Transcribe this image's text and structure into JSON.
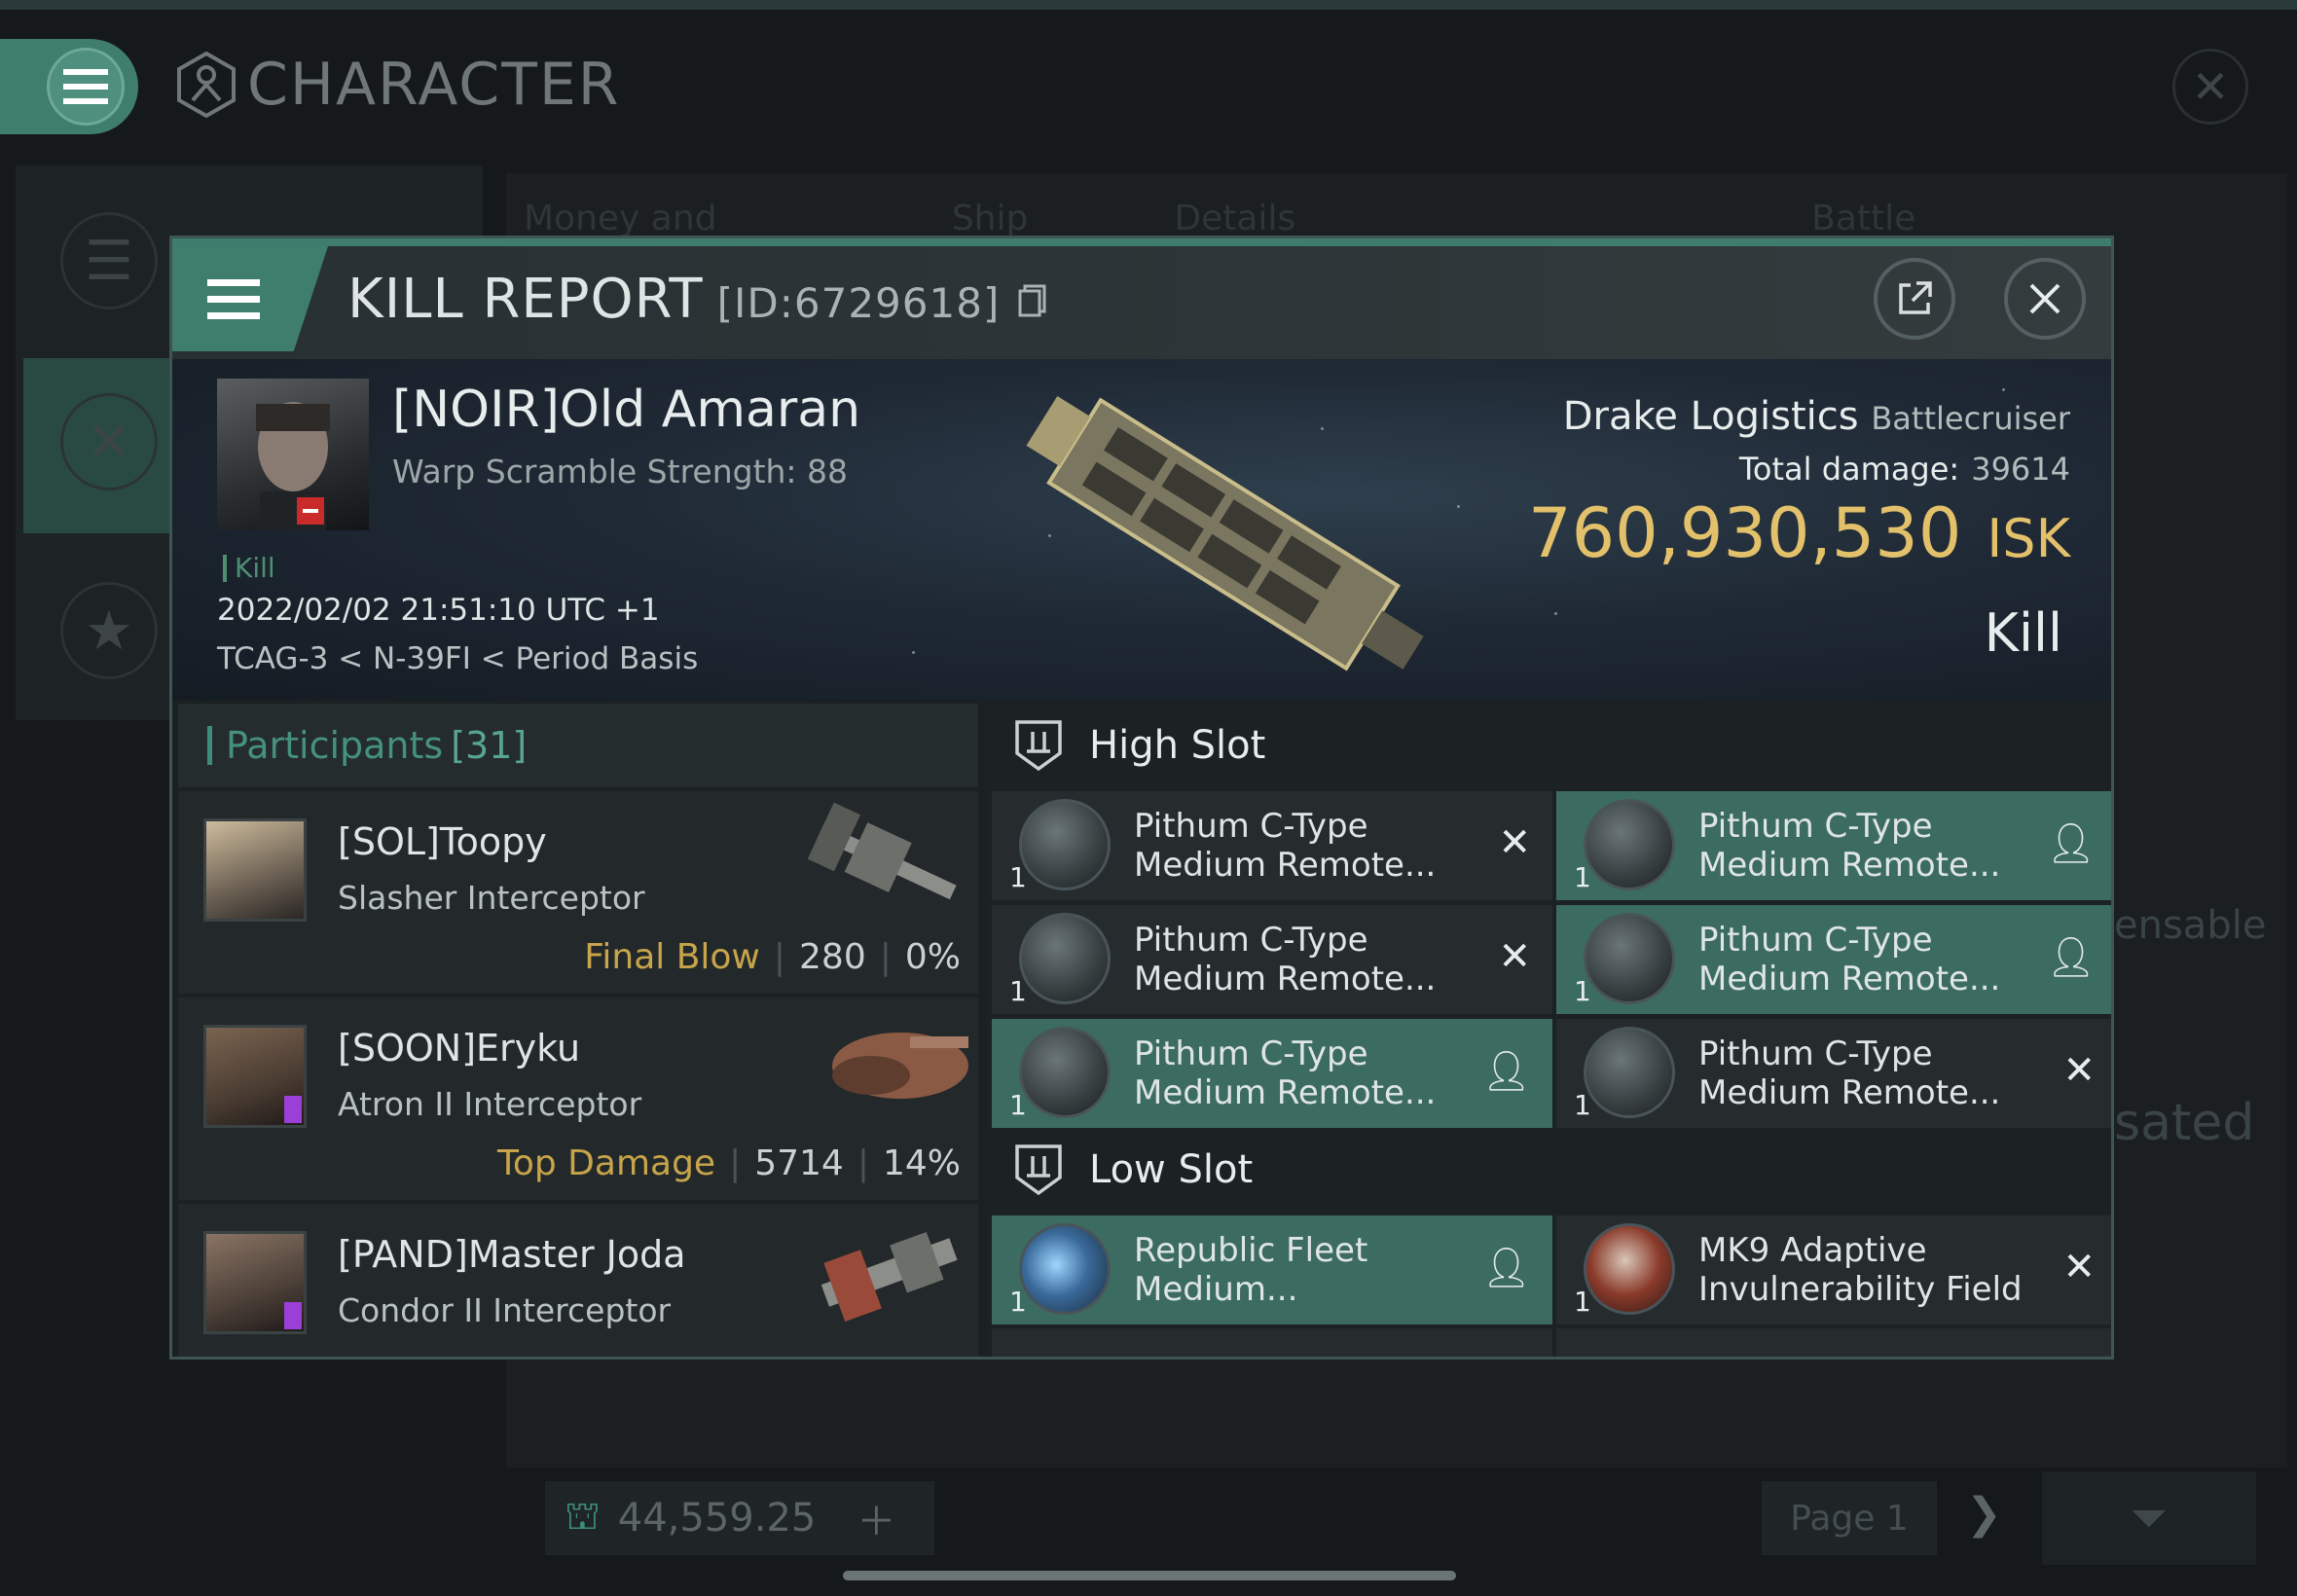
{
  "background": {
    "title": "CHARACTER",
    "tabs": [
      "Money and Time",
      "Ship",
      "Details",
      "Battle Status"
    ],
    "right_fragments": [
      "ensable",
      "sated"
    ],
    "wallet_value": "44,559.25",
    "page_label": "Page 1"
  },
  "dialog": {
    "title": "KILL REPORT",
    "id_label": "[ID:6729618]",
    "victim": {
      "name": "[NOIR]Old Amaran",
      "subtitle": "Warp Scramble Strength: 88",
      "tag": "Kill",
      "datetime": "2022/02/02 21:51:10 UTC +1",
      "location": "TCAG-3 < N-39FI < Period Basis"
    },
    "ship": {
      "name": "Drake Logistics",
      "class": "Battlecruiser",
      "total_damage_label": "Total damage:",
      "total_damage": "39614",
      "isk_value": "760,930,530",
      "isk_unit": "ISK",
      "result": "Kill"
    },
    "participants": {
      "label": "Participants",
      "count": "[31]",
      "rows": [
        {
          "name": "[SOL]Toopy",
          "ship": "Slasher Interceptor",
          "role": "Final Blow",
          "damage": "280",
          "percent": "0%"
        },
        {
          "name": "[SOON]Eryku",
          "ship": "Atron II Interceptor",
          "role": "Top Damage",
          "damage": "5714",
          "percent": "14%"
        },
        {
          "name": "[PAND]Master Joda",
          "ship": "Condor II Interceptor",
          "role": "",
          "damage": "",
          "percent": ""
        }
      ]
    },
    "high_slot": {
      "label": "High Slot",
      "modules": [
        {
          "name": "Pithum C-Type Medium Remote...",
          "qty": "1",
          "state": "destroyed"
        },
        {
          "name": "Pithum C-Type Medium Remote...",
          "qty": "1",
          "state": "dropped"
        },
        {
          "name": "Pithum C-Type Medium Remote...",
          "qty": "1",
          "state": "destroyed"
        },
        {
          "name": "Pithum C-Type Medium Remote...",
          "qty": "1",
          "state": "dropped"
        },
        {
          "name": "Pithum C-Type Medium Remote...",
          "qty": "1",
          "state": "dropped"
        },
        {
          "name": "Pithum C-Type Medium Remote...",
          "qty": "1",
          "state": "destroyed"
        }
      ]
    },
    "low_slot": {
      "label": "Low Slot",
      "modules": [
        {
          "name": "Republic Fleet Medium...",
          "qty": "1",
          "state": "dropped"
        },
        {
          "name": "MK9 Adaptive Invulnerability Field",
          "qty": "1",
          "state": "destroyed"
        }
      ]
    }
  },
  "colors": {
    "accent": "#3f7d6c",
    "isk_gold": "#e3c06a",
    "highlight_gold": "#c8a44a",
    "module_fit_bg": "#3c6c61"
  }
}
